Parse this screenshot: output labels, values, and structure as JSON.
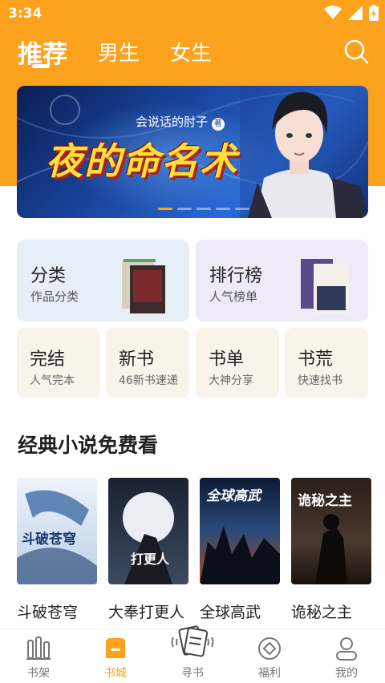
{
  "status": {
    "time": "3:34"
  },
  "tabs": [
    {
      "label": "推荐",
      "active": true
    },
    {
      "label": "男生",
      "active": false
    },
    {
      "label": "女生",
      "active": false
    }
  ],
  "search_icon": "search-icon",
  "banner": {
    "author": "会说话的肘子",
    "author_badge": "著",
    "title": "夜的命名术",
    "dots": 5,
    "active_dot": 0
  },
  "category_cards": [
    {
      "title": "分类",
      "sub": "作品分类",
      "bg": "#e6eef8"
    },
    {
      "title": "排行榜",
      "sub": "人气榜单",
      "bg": "#eeeaf8"
    }
  ],
  "small_cards": [
    {
      "title": "完结",
      "sub": "人气完本"
    },
    {
      "title": "新书",
      "sub": "46新书速递"
    },
    {
      "title": "书单",
      "sub": "大神分享"
    },
    {
      "title": "书荒",
      "sub": "快速找书"
    }
  ],
  "section": {
    "title": "经典小说免费看",
    "books": [
      {
        "name": "斗破苍穹",
        "cover_text": "斗破苍穹"
      },
      {
        "name": "大奉打更人",
        "cover_text": "打更人"
      },
      {
        "name": "全球高武",
        "cover_text": "全球高武"
      },
      {
        "name": "诡秘之主",
        "cover_text": "诡秘之主"
      }
    ]
  },
  "bottom_nav": [
    {
      "label": "书架",
      "icon": "bookshelf-icon",
      "active": false
    },
    {
      "label": "书城",
      "icon": "bookstore-icon",
      "active": true
    },
    {
      "label": "寻书",
      "icon": "find-book-icon",
      "active": false
    },
    {
      "label": "福利",
      "icon": "welfare-icon",
      "active": false
    },
    {
      "label": "我的",
      "icon": "profile-icon",
      "active": false
    }
  ],
  "colors": {
    "accent": "#FDA21D",
    "text": "#222222",
    "muted": "#777777"
  }
}
